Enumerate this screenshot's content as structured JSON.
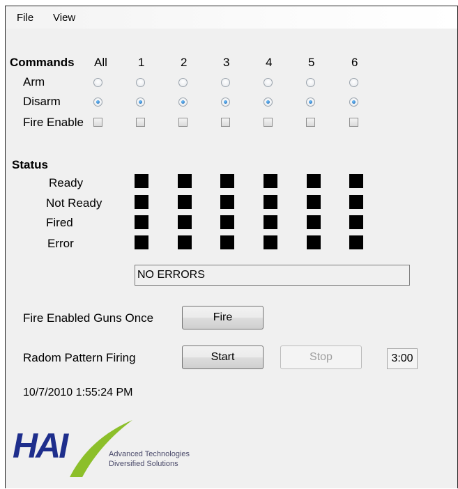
{
  "menu": {
    "file": "File",
    "view": "View"
  },
  "commands": {
    "heading": "Commands",
    "columns": [
      "All",
      "1",
      "2",
      "3",
      "4",
      "5",
      "6"
    ],
    "arm_label": "Arm",
    "disarm_label": "Disarm",
    "fire_enable_label": "Fire Enable",
    "arm_selected": [
      false,
      false,
      false,
      false,
      false,
      false,
      false
    ],
    "disarm_selected": [
      true,
      true,
      true,
      true,
      true,
      true,
      true
    ],
    "fire_enable_checked": [
      false,
      false,
      false,
      false,
      false,
      false,
      false
    ]
  },
  "status": {
    "heading": "Status",
    "rows": [
      "Ready",
      "Not Ready",
      "Fired",
      "Error"
    ],
    "indicator_color": "#000000",
    "message": "NO ERRORS"
  },
  "fire_once": {
    "label": "Fire Enabled Guns Once",
    "button": "Fire"
  },
  "pattern": {
    "label": "Radom Pattern Firing",
    "start_button": "Start",
    "stop_button": "Stop",
    "interval": "3:00"
  },
  "timestamp": "10/7/2010 1:55:24 PM",
  "logo": {
    "name": "HAI",
    "tagline_1": "Advanced Technologies",
    "tagline_2": "Diversified Solutions",
    "brand_color": "#1e2e8c",
    "accent_color": "#8cbf2a"
  }
}
